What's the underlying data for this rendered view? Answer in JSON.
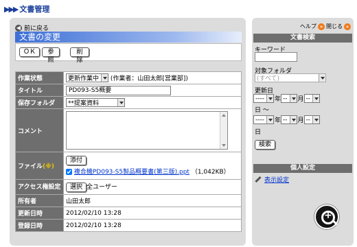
{
  "header": {
    "title": "文書管理"
  },
  "main": {
    "back_label": "前に戻る",
    "page_title": "文書の変更",
    "buttons": {
      "ok": "ＯＫ",
      "ref": "参照",
      "del": "削除"
    },
    "rows": {
      "status": {
        "label": "作業状態",
        "value": "更新作業中",
        "note": "(作業者：山田太郎[営業部])"
      },
      "title": {
        "label": "タイトル",
        "value": "PD093-S5概要"
      },
      "folder": {
        "label": "保存フォルダ",
        "value": "**提案資料"
      },
      "comment": {
        "label": "コメント",
        "value": ""
      },
      "file": {
        "label": "ファイル",
        "req": "(※)",
        "attach": "添付",
        "filename": "複合機PD093-S5製品概要書(第三版).ppt",
        "size": "（1,042KB）"
      },
      "access": {
        "label": "アクセス権設定",
        "select_btn": "選択",
        "value": "全ユーザー"
      },
      "owner": {
        "label": "所有者",
        "value": "山田太郎"
      },
      "updated": {
        "label": "更新日時",
        "value": "2012/02/10 13:28"
      },
      "created": {
        "label": "登録日時",
        "value": "2012/02/10 13:28"
      }
    }
  },
  "side": {
    "help": "ヘルプ",
    "close": "閉じる",
    "search_title": "文書検索",
    "keyword_label": "キーワード",
    "keyword_value": "",
    "folder_label": "対象フォルダ",
    "folder_value": "(すべて)",
    "updated_label": "更新日",
    "date_blank_year": "----",
    "date_blank": "--",
    "year": "年",
    "month": "月",
    "day": "日",
    "tilde": "日 ～",
    "search_btn": "検索",
    "personal_title": "個人設定",
    "display_link": "表示設定"
  }
}
